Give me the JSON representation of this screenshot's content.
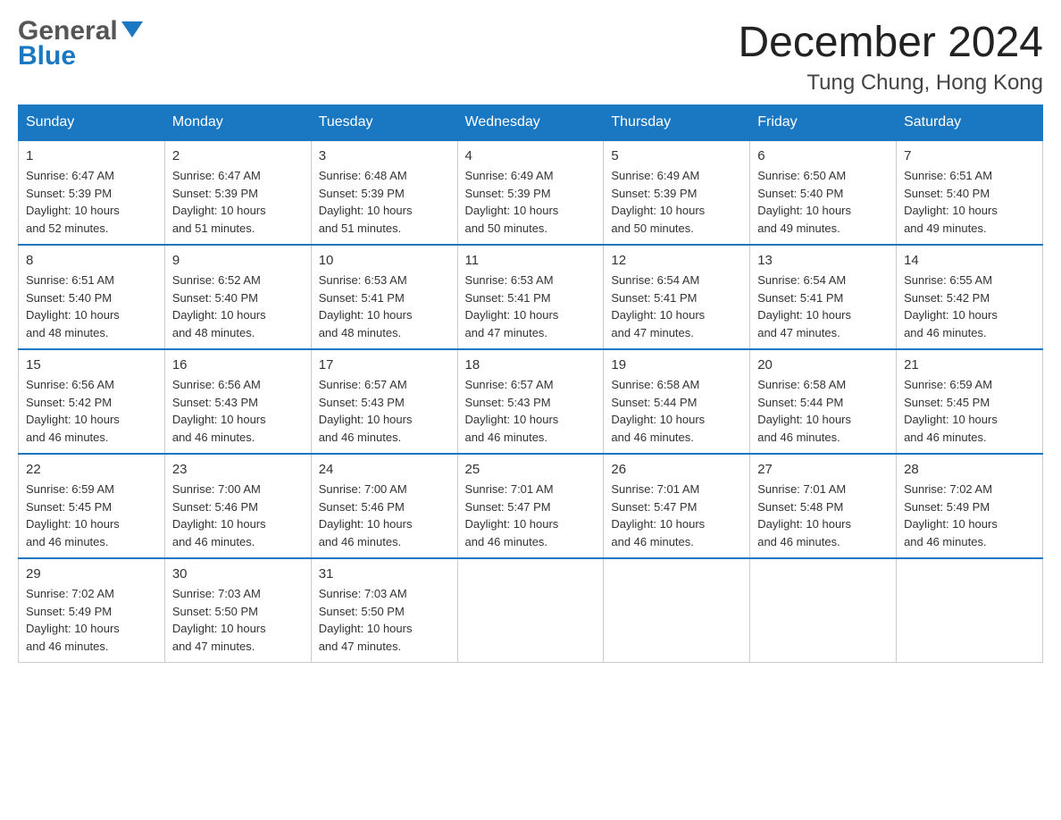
{
  "header": {
    "logo_line1": "General",
    "logo_line2": "Blue",
    "month": "December 2024",
    "location": "Tung Chung, Hong Kong"
  },
  "weekdays": [
    "Sunday",
    "Monday",
    "Tuesday",
    "Wednesday",
    "Thursday",
    "Friday",
    "Saturday"
  ],
  "weeks": [
    [
      {
        "day": "1",
        "sunrise": "6:47 AM",
        "sunset": "5:39 PM",
        "daylight": "10 hours and 52 minutes."
      },
      {
        "day": "2",
        "sunrise": "6:47 AM",
        "sunset": "5:39 PM",
        "daylight": "10 hours and 51 minutes."
      },
      {
        "day": "3",
        "sunrise": "6:48 AM",
        "sunset": "5:39 PM",
        "daylight": "10 hours and 51 minutes."
      },
      {
        "day": "4",
        "sunrise": "6:49 AM",
        "sunset": "5:39 PM",
        "daylight": "10 hours and 50 minutes."
      },
      {
        "day": "5",
        "sunrise": "6:49 AM",
        "sunset": "5:39 PM",
        "daylight": "10 hours and 50 minutes."
      },
      {
        "day": "6",
        "sunrise": "6:50 AM",
        "sunset": "5:40 PM",
        "daylight": "10 hours and 49 minutes."
      },
      {
        "day": "7",
        "sunrise": "6:51 AM",
        "sunset": "5:40 PM",
        "daylight": "10 hours and 49 minutes."
      }
    ],
    [
      {
        "day": "8",
        "sunrise": "6:51 AM",
        "sunset": "5:40 PM",
        "daylight": "10 hours and 48 minutes."
      },
      {
        "day": "9",
        "sunrise": "6:52 AM",
        "sunset": "5:40 PM",
        "daylight": "10 hours and 48 minutes."
      },
      {
        "day": "10",
        "sunrise": "6:53 AM",
        "sunset": "5:41 PM",
        "daylight": "10 hours and 48 minutes."
      },
      {
        "day": "11",
        "sunrise": "6:53 AM",
        "sunset": "5:41 PM",
        "daylight": "10 hours and 47 minutes."
      },
      {
        "day": "12",
        "sunrise": "6:54 AM",
        "sunset": "5:41 PM",
        "daylight": "10 hours and 47 minutes."
      },
      {
        "day": "13",
        "sunrise": "6:54 AM",
        "sunset": "5:41 PM",
        "daylight": "10 hours and 47 minutes."
      },
      {
        "day": "14",
        "sunrise": "6:55 AM",
        "sunset": "5:42 PM",
        "daylight": "10 hours and 46 minutes."
      }
    ],
    [
      {
        "day": "15",
        "sunrise": "6:56 AM",
        "sunset": "5:42 PM",
        "daylight": "10 hours and 46 minutes."
      },
      {
        "day": "16",
        "sunrise": "6:56 AM",
        "sunset": "5:43 PM",
        "daylight": "10 hours and 46 minutes."
      },
      {
        "day": "17",
        "sunrise": "6:57 AM",
        "sunset": "5:43 PM",
        "daylight": "10 hours and 46 minutes."
      },
      {
        "day": "18",
        "sunrise": "6:57 AM",
        "sunset": "5:43 PM",
        "daylight": "10 hours and 46 minutes."
      },
      {
        "day": "19",
        "sunrise": "6:58 AM",
        "sunset": "5:44 PM",
        "daylight": "10 hours and 46 minutes."
      },
      {
        "day": "20",
        "sunrise": "6:58 AM",
        "sunset": "5:44 PM",
        "daylight": "10 hours and 46 minutes."
      },
      {
        "day": "21",
        "sunrise": "6:59 AM",
        "sunset": "5:45 PM",
        "daylight": "10 hours and 46 minutes."
      }
    ],
    [
      {
        "day": "22",
        "sunrise": "6:59 AM",
        "sunset": "5:45 PM",
        "daylight": "10 hours and 46 minutes."
      },
      {
        "day": "23",
        "sunrise": "7:00 AM",
        "sunset": "5:46 PM",
        "daylight": "10 hours and 46 minutes."
      },
      {
        "day": "24",
        "sunrise": "7:00 AM",
        "sunset": "5:46 PM",
        "daylight": "10 hours and 46 minutes."
      },
      {
        "day": "25",
        "sunrise": "7:01 AM",
        "sunset": "5:47 PM",
        "daylight": "10 hours and 46 minutes."
      },
      {
        "day": "26",
        "sunrise": "7:01 AM",
        "sunset": "5:47 PM",
        "daylight": "10 hours and 46 minutes."
      },
      {
        "day": "27",
        "sunrise": "7:01 AM",
        "sunset": "5:48 PM",
        "daylight": "10 hours and 46 minutes."
      },
      {
        "day": "28",
        "sunrise": "7:02 AM",
        "sunset": "5:49 PM",
        "daylight": "10 hours and 46 minutes."
      }
    ],
    [
      {
        "day": "29",
        "sunrise": "7:02 AM",
        "sunset": "5:49 PM",
        "daylight": "10 hours and 46 minutes."
      },
      {
        "day": "30",
        "sunrise": "7:03 AM",
        "sunset": "5:50 PM",
        "daylight": "10 hours and 47 minutes."
      },
      {
        "day": "31",
        "sunrise": "7:03 AM",
        "sunset": "5:50 PM",
        "daylight": "10 hours and 47 minutes."
      },
      null,
      null,
      null,
      null
    ]
  ],
  "labels": {
    "sunrise": "Sunrise:",
    "sunset": "Sunset:",
    "daylight": "Daylight:"
  }
}
